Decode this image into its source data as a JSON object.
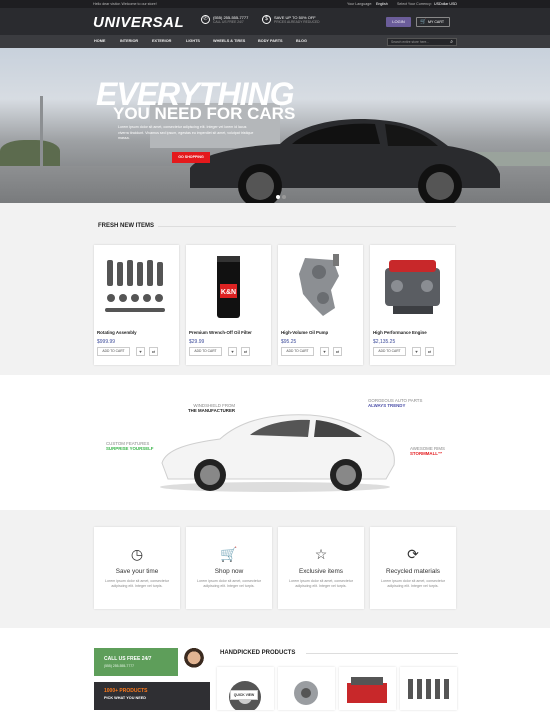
{
  "topbar": {
    "welcome": "Hello dear visitor. Welcome to our store!",
    "language_label": "Your Language:",
    "language_value": "English",
    "currency_label": "Select Your Currency:",
    "currency_value": "USDollar USD"
  },
  "header": {
    "logo": "UNIVERSAL",
    "phone": "(555) 255-555-7777",
    "phone_sub": "CALL US FREE 24/7",
    "save": "SAVE UP TO 50% OFF",
    "save_sub": "PRICES ALREADY REDUCED",
    "login": "LOGIN",
    "cart": "MY CART"
  },
  "nav": {
    "items": [
      "HOME",
      "INTERIOR",
      "EXTERIOR",
      "LIGHTS",
      "WHEELS & TIRES",
      "BODY PARTS",
      "BLOG"
    ],
    "search_placeholder": "Search entire store here..."
  },
  "hero": {
    "headline1": "EVERYTHING",
    "headline2": "YOU NEED FOR CARS",
    "text": "Lorem ipsum dolor sit amet, consectetur adipiscing elit. Integer vel lorem id lacus viverra tincidunt. Vivamus sed ipsum, egestas eu imperdiet sit amet, volutpat tristique massa.",
    "button": "GO SHOPPING"
  },
  "fresh": {
    "title": "FRESH NEW ITEMS",
    "add_to_cart": "ADD TO CART",
    "products": [
      {
        "name": "Rotating Assembly",
        "price": "$999.99"
      },
      {
        "name": "Premium Wrench-Off Oil Filter",
        "price": "$29.99"
      },
      {
        "name": "High-Volume Oil Pump",
        "price": "$95.25"
      },
      {
        "name": "High Performance Engine",
        "price": "$2,135.25"
      }
    ]
  },
  "promo": {
    "windshield_1": "WINDSHIELD FROM",
    "windshield_2": "THE MANUFACTURER",
    "autoparts_1": "GORGEOUS AUTO PARTS",
    "autoparts_2": "ALWAYS TRENDY",
    "custom_1": "CUSTOM FEATURES",
    "custom_2": "SURPRISE YOURSELF",
    "rims_1": "AWESOME RIMS",
    "rims_2": "STORMMALL™",
    "colors": {
      "purple": "#4b4fa8",
      "green": "#39b54a",
      "red": "#e4191c"
    }
  },
  "features": [
    {
      "icon": "clock-icon",
      "title": "Save your time",
      "desc": "Lorem ipsum dolor sit amet, consectetur adipiscing elit. Integer vel turpis."
    },
    {
      "icon": "cart-icon",
      "title": "Shop now",
      "desc": "Lorem ipsum dolor sit amet, consectetur adipiscing elit. Integer vel turpis."
    },
    {
      "icon": "star-icon",
      "title": "Exclusive items",
      "desc": "Lorem ipsum dolor sit amet, consectetur adipiscing elit. Integer vel turpis."
    },
    {
      "icon": "refresh-icon",
      "title": "Recycled materials",
      "desc": "Lorem ipsum dolor sit amet, consectetur adipiscing elit. Integer vel turpis."
    }
  ],
  "bottom": {
    "banner1_title": "CALL US FREE 24/7",
    "banner1_sub": "(555) 255-555-7777",
    "banner2_title": "1000+ PRODUCTS",
    "banner2_sub": "PICK WHAT YOU NEED",
    "handpicked_title": "HANDPICKED PRODUCTS",
    "quick_view": "QUICK VIEW"
  }
}
